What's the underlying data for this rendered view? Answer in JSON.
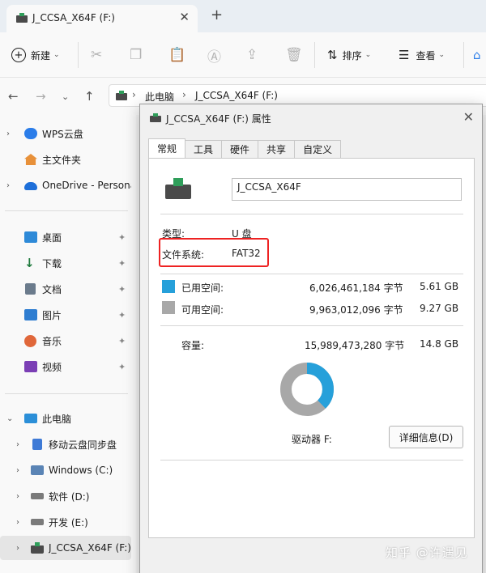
{
  "window": {
    "tab_title": "J_CCSA_X64F (F:)",
    "tab_close": "✕",
    "new_tab": "+"
  },
  "toolbar": {
    "new_label": "新建",
    "sort_label": "排序",
    "view_label": "查看",
    "icons": [
      "cut-icon",
      "copy-icon",
      "paste-icon",
      "rename-icon",
      "share-icon",
      "delete-icon"
    ]
  },
  "breadcrumb": {
    "items": [
      "此电脑",
      "J_CCSA_X64F (F:)"
    ],
    "separator": "›"
  },
  "sidebar": {
    "groups": [
      {
        "items": [
          {
            "label": "WPS云盘",
            "has_chevron": true,
            "icon": "cloud-icon",
            "color": "#2b7de9"
          },
          {
            "label": "主文件夹",
            "has_chevron": false,
            "icon": "home-icon",
            "color": "#e8913a"
          },
          {
            "label": "OneDrive - Persona",
            "has_chevron": true,
            "icon": "onedrive-icon",
            "color": "#1e6fd9"
          }
        ]
      },
      {
        "items": [
          {
            "label": "桌面",
            "icon": "desktop-icon",
            "color": "#2e8ad8",
            "pinned": true
          },
          {
            "label": "下载",
            "icon": "download-icon",
            "color": "#1f7a3d",
            "pinned": true
          },
          {
            "label": "文档",
            "icon": "documents-icon",
            "color": "#6b7b8c",
            "pinned": true
          },
          {
            "label": "图片",
            "icon": "pictures-icon",
            "color": "#2e7dd1",
            "pinned": true
          },
          {
            "label": "音乐",
            "icon": "music-icon",
            "color": "#e0673a",
            "pinned": true
          },
          {
            "label": "视频",
            "icon": "videos-icon",
            "color": "#7b3fb5",
            "pinned": true
          }
        ]
      },
      {
        "items": [
          {
            "label": "此电脑",
            "icon": "this-pc-icon",
            "color": "#2b8fd8",
            "expanded": true
          },
          {
            "label": "移动云盘同步盘",
            "icon": "sync-drive-icon",
            "color": "#3e7ad6",
            "indent": true
          },
          {
            "label": "Windows (C:)",
            "icon": "windows-drive-icon",
            "color": "#5a84b5",
            "indent": true
          },
          {
            "label": "软件 (D:)",
            "icon": "drive-icon",
            "color": "#7a7a7a",
            "indent": true
          },
          {
            "label": "开发 (E:)",
            "icon": "drive-icon",
            "color": "#7a7a7a",
            "indent": true
          },
          {
            "label": "J_CCSA_X64F (F:)",
            "icon": "usb-drive-icon",
            "color": "#2f9e5a",
            "indent": true,
            "selected": true
          }
        ]
      }
    ],
    "pin_glyph": "📌",
    "chevron": "›",
    "chevron_open": "⌄"
  },
  "dialog": {
    "title": "J_CCSA_X64F (F:) 属性",
    "close": "✕",
    "tabs": [
      "常规",
      "工具",
      "硬件",
      "共享",
      "自定义"
    ],
    "active_tab": 0,
    "volume_name": "J_CCSA_X64F",
    "type_label": "类型:",
    "type_value": "U 盘",
    "fs_label": "文件系统:",
    "fs_value": "FAT32",
    "used_label": "已用空间:",
    "used_bytes": "6,026,461,184 字节",
    "used_size": "5.61 GB",
    "free_label": "可用空间:",
    "free_bytes": "9,963,012,096 字节",
    "free_size": "9.27 GB",
    "capacity_label": "容量:",
    "capacity_bytes": "15,989,473,280 字节",
    "capacity_size": "14.8 GB",
    "drive_label": "驱动器 F:",
    "details_button": "详细信息(D)",
    "used_fraction": 0.3769,
    "used_color": "#26a0da",
    "free_color": "#a8a8a8"
  },
  "watermark": "知乎 @许遇见",
  "colors": {
    "highlight": "#e22222",
    "accent": "#26a0da"
  }
}
